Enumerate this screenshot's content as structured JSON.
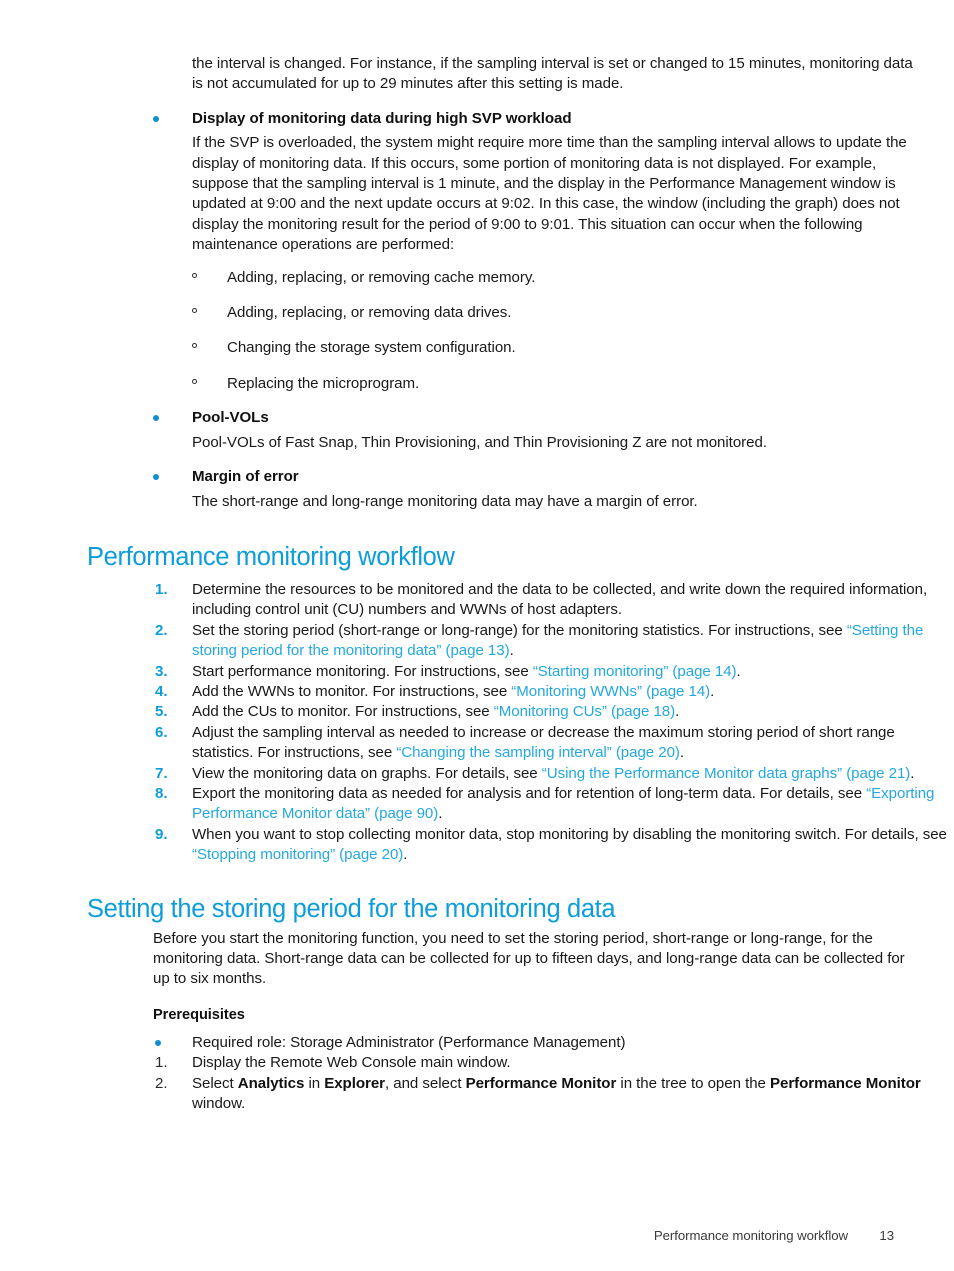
{
  "colors": {
    "heading": "#0d9ddb",
    "link": "#25a8e0",
    "bullet": "#108fd0",
    "body_text": "#191919"
  },
  "continuation_paragraph": "the interval is changed. For instance, if the sampling interval is set or changed to 15 minutes, monitoring data is not accumulated for up to 29 minutes after this setting is made.",
  "notes": [
    {
      "term": "Display of monitoring data during high SVP workload",
      "body": "If the SVP is overloaded, the system might require more time than the sampling interval allows to update the display of monitoring data. If this occurs, some portion of monitoring data is not displayed. For example, suppose that the sampling interval is 1 minute, and the display in the Performance Management window is updated at 9:00 and the next update occurs at 9:02. In this case, the window (including the graph) does not display the monitoring result for the period of 9:00 to 9:01. This situation can occur when the following maintenance operations are performed:",
      "sub_items": [
        "Adding, replacing, or removing cache memory.",
        "Adding, replacing, or removing data drives.",
        "Changing the storage system configuration.",
        "Replacing the microprogram."
      ]
    },
    {
      "term": "Pool-VOLs",
      "body": "Pool-VOLs of Fast Snap, Thin Provisioning, and Thin Provisioning Z are not monitored.",
      "sub_items": []
    },
    {
      "term": "Margin of error",
      "body": "The short-range and long-range monitoring data may have a margin of error.",
      "sub_items": []
    }
  ],
  "workflow_section": {
    "heading": "Performance monitoring workflow",
    "steps": [
      {
        "num": "1.",
        "parts": [
          {
            "type": "text",
            "value": "Determine the resources to be monitored and the data to be collected, and write down the required information, including control unit (CU) numbers and WWNs of host adapters."
          }
        ]
      },
      {
        "num": "2.",
        "parts": [
          {
            "type": "text",
            "value": "Set the storing period (short-range or long-range) for the monitoring statistics. For instructions, see "
          },
          {
            "type": "link",
            "value": "“Setting the storing period for the monitoring data” (page 13)"
          },
          {
            "type": "text",
            "value": "."
          }
        ]
      },
      {
        "num": "3.",
        "parts": [
          {
            "type": "text",
            "value": "Start performance monitoring. For instructions, see "
          },
          {
            "type": "link",
            "value": "“Starting monitoring” (page 14)"
          },
          {
            "type": "text",
            "value": "."
          }
        ]
      },
      {
        "num": "4.",
        "parts": [
          {
            "type": "text",
            "value": "Add the WWNs to monitor. For instructions, see "
          },
          {
            "type": "link",
            "value": "“Monitoring WWNs” (page 14)"
          },
          {
            "type": "text",
            "value": "."
          }
        ]
      },
      {
        "num": "5.",
        "parts": [
          {
            "type": "text",
            "value": "Add the CUs to monitor. For instructions, see "
          },
          {
            "type": "link",
            "value": "“Monitoring CUs” (page 18)"
          },
          {
            "type": "text",
            "value": "."
          }
        ]
      },
      {
        "num": "6.",
        "parts": [
          {
            "type": "text",
            "value": "Adjust the sampling interval as needed to increase or decrease the maximum storing period of short range statistics. For instructions, see "
          },
          {
            "type": "link",
            "value": "“Changing the sampling interval” (page 20)"
          },
          {
            "type": "text",
            "value": "."
          }
        ]
      },
      {
        "num": "7.",
        "parts": [
          {
            "type": "text",
            "value": "View the monitoring data on graphs. For details, see "
          },
          {
            "type": "link",
            "value": "“Using the Performance Monitor data graphs” (page 21)"
          },
          {
            "type": "text",
            "value": "."
          }
        ]
      },
      {
        "num": "8.",
        "parts": [
          {
            "type": "text",
            "value": "Export the monitoring data as needed for analysis and for retention of long-term data. For details, see "
          },
          {
            "type": "link",
            "value": "“Exporting Performance Monitor data” (page 90)"
          },
          {
            "type": "text",
            "value": "."
          }
        ]
      },
      {
        "num": "9.",
        "parts": [
          {
            "type": "text",
            "value": "When you want to stop collecting monitor data, stop monitoring by disabling the monitoring switch. For details, see "
          },
          {
            "type": "link",
            "value": "“Stopping monitoring” (page 20)"
          },
          {
            "type": "text",
            "value": "."
          }
        ]
      }
    ]
  },
  "storing_period_section": {
    "heading": "Setting the storing period for the monitoring data",
    "intro": "Before you start the monitoring function, you need to set the storing period, short-range or long-range, for the monitoring data. Short-range data can be collected for up to fifteen days, and long-range data can be collected for up to six months.",
    "prerequisites_label": "Prerequisites",
    "prerequisite_bullet": "Required role: Storage Administrator (Performance Management)",
    "prerequisite_steps": [
      {
        "num": "1.",
        "parts": [
          {
            "type": "text",
            "value": "Display the Remote Web Console main window."
          }
        ]
      },
      {
        "num": "2.",
        "parts": [
          {
            "type": "text",
            "value": "Select "
          },
          {
            "type": "bold",
            "value": "Analytics"
          },
          {
            "type": "text",
            "value": " in "
          },
          {
            "type": "bold",
            "value": "Explorer"
          },
          {
            "type": "text",
            "value": ", and select "
          },
          {
            "type": "bold",
            "value": "Performance Monitor"
          },
          {
            "type": "text",
            "value": " in the tree to open the "
          },
          {
            "type": "bold",
            "value": "Performance Monitor"
          },
          {
            "type": "text",
            "value": " window."
          }
        ]
      }
    ]
  },
  "footer": {
    "title": "Performance monitoring workflow",
    "page": "13"
  }
}
